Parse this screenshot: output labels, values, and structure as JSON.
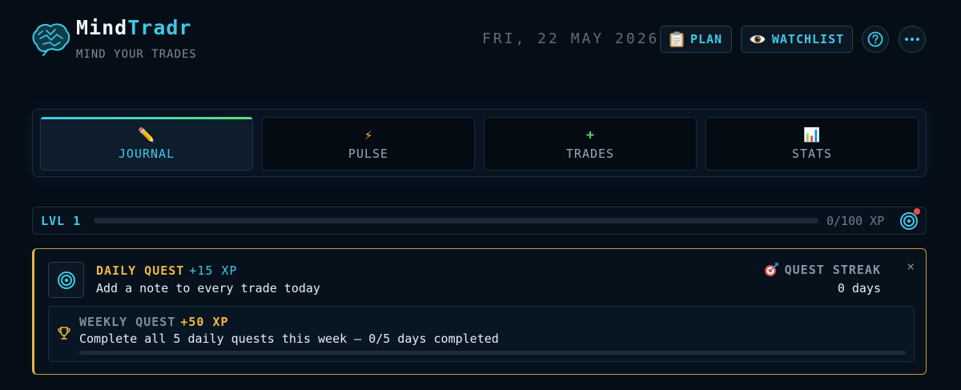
{
  "brand": {
    "name_part1": "Mind",
    "name_part2": "Tradr",
    "tagline": "MIND YOUR TRADES"
  },
  "header": {
    "date": "FRI, 22 MAY 2026",
    "plan_label": "PLAN",
    "watchlist_label": "WATCHLIST",
    "plan_icon": "clipboard-icon",
    "watchlist_icon": "eye-icon"
  },
  "tabs": [
    {
      "label": "JOURNAL",
      "icon": "✏️",
      "active": true
    },
    {
      "label": "PULSE",
      "icon": "⚡",
      "active": false
    },
    {
      "label": "TRADES",
      "icon": "+",
      "active": false
    },
    {
      "label": "STATS",
      "icon": "📊",
      "active": false
    }
  ],
  "level": {
    "label": "LVL 1",
    "xp_text": "0/100 XP",
    "progress": 0.0
  },
  "daily_quest": {
    "title": "DAILY QUEST",
    "xp": "+15 XP",
    "description": "Add a note to every trade today",
    "streak_label": "QUEST STREAK",
    "streak_value": "0 days",
    "close": "×"
  },
  "weekly_quest": {
    "title": "WEEKLY QUEST",
    "xp": "+50 XP",
    "description": "Complete all 5 daily quests this week — 0/5 days completed",
    "progress": 0.0
  },
  "colors": {
    "accent": "#3ec9e6",
    "gold": "#f0b73f",
    "green": "#5ee07a",
    "alert": "#f04a4a"
  }
}
